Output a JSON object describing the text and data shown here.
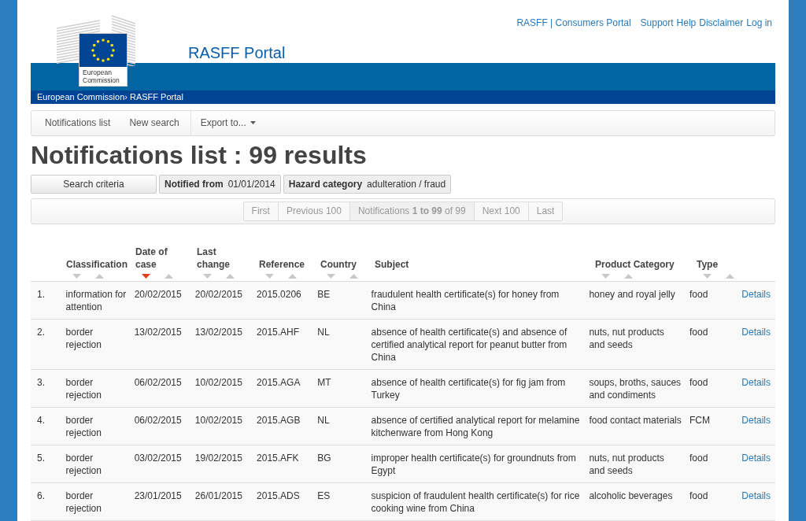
{
  "header": {
    "logo_text": "European Commission",
    "site_title": "RASFF Portal",
    "top_links": [
      {
        "label": "RASFF | Consumers Portal"
      },
      {
        "label": "Support"
      },
      {
        "label": "Help"
      },
      {
        "label": "Disclaimer"
      },
      {
        "label": "Log in"
      }
    ]
  },
  "breadcrumb": "European Commission› RASFF Portal",
  "toolbar": [
    {
      "label": "Notifications list",
      "dropdown": false
    },
    {
      "label": "New search",
      "dropdown": false
    },
    {
      "label": "Export to...",
      "dropdown": true
    }
  ],
  "page_title": "Notifications list : 99 results",
  "filters": {
    "button": "Search criteria",
    "chips": [
      {
        "name": "Notified from",
        "value": "01/01/2014"
      },
      {
        "name": "Hazard category",
        "value": "adulteration / fraud"
      }
    ]
  },
  "pagination": {
    "first": "First",
    "previous": "Previous 100",
    "info": "Notifications **1 to 99** of 99",
    "next": "Next 100",
    "last": "Last"
  },
  "table": {
    "columns": [
      {
        "label": "Classification",
        "sortable": true,
        "sorted": false
      },
      {
        "label": "Date of case",
        "sortable": true,
        "sorted": true
      },
      {
        "label": "Last change",
        "sortable": true,
        "sorted": false
      },
      {
        "label": "Reference",
        "sortable": true,
        "sorted": false
      },
      {
        "label": "Country",
        "sortable": true,
        "sorted": false
      },
      {
        "label": "Subject",
        "sortable": false
      },
      {
        "label": "Product Category",
        "sortable": true,
        "sorted": false
      },
      {
        "label": "Type",
        "sortable": true,
        "sorted": false
      }
    ],
    "rows": [
      {
        "index": "1.",
        "cells": [
          "information for attention",
          "20/02/2015",
          "20/02/2015",
          "2015.0206",
          "BE",
          "fraudulent health certificate(s) for honey from China",
          "honey and royal jelly",
          "food"
        ],
        "link": "Details"
      },
      {
        "index": "2.",
        "cells": [
          "border rejection",
          "13/02/2015",
          "13/02/2015",
          "2015.AHF",
          "NL",
          "absence of health certificate(s) and absence of certified analytical report for peanut butter from China",
          "nuts, nut products and seeds",
          "food"
        ],
        "link": "Details"
      },
      {
        "index": "3.",
        "cells": [
          "border rejection",
          "06/02/2015",
          "10/02/2015",
          "2015.AGA",
          "MT",
          "absence of health certificate(s) for fig jam from Turkey",
          "soups, broths, sauces and condiments",
          "food"
        ],
        "link": "Details"
      },
      {
        "index": "4.",
        "cells": [
          "border rejection",
          "06/02/2015",
          "10/02/2015",
          "2015.AGB",
          "NL",
          "absence of certified analytical report for melamine kitchenware from Hong Kong",
          "food contact materials",
          "FCM"
        ],
        "link": "Details"
      },
      {
        "index": "5.",
        "cells": [
          "border rejection",
          "03/02/2015",
          "19/02/2015",
          "2015.AFK",
          "BG",
          "improper health certificate(s) for groundnuts from Egypt",
          "nuts, nut products and seeds",
          "food"
        ],
        "link": "Details"
      },
      {
        "index": "6.",
        "cells": [
          "border rejection",
          "23/01/2015",
          "26/01/2015",
          "2015.ADS",
          "ES",
          "suspicion of fraudulent health certificate(s) for rice cooking wine from China",
          "alcoholic beverages",
          "food"
        ],
        "link": "Details"
      }
    ]
  }
}
